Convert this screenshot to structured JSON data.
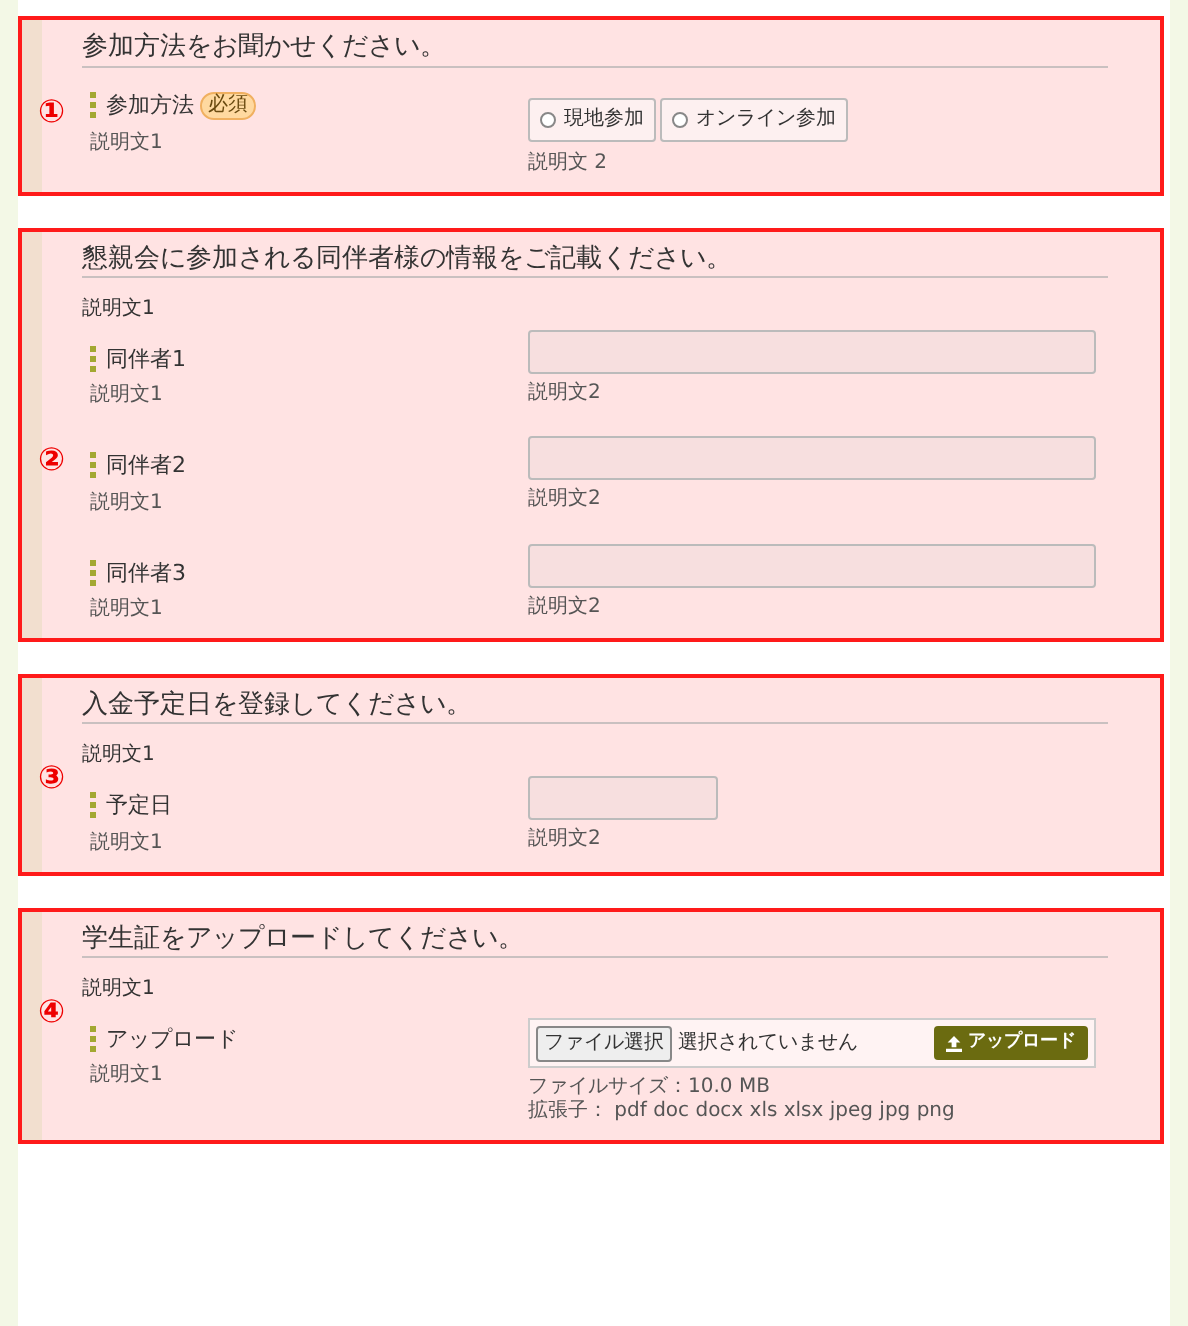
{
  "sections": [
    {
      "number": "①",
      "heading": "参加方法をお聞かせください。",
      "fields": [
        {
          "kind": "radio",
          "label": "参加方法",
          "required_badge": "必須",
          "note": "説明文1",
          "options": [
            {
              "label": "現地参加",
              "selected": false
            },
            {
              "label": "オンライン参加",
              "selected": false
            }
          ],
          "help": "説明文 2"
        }
      ]
    },
    {
      "number": "②",
      "heading": "懇親会に参加される同伴者様の情報をご記載ください。",
      "description": "説明文1",
      "fields": [
        {
          "kind": "text",
          "label": "同伴者1",
          "note": "説明文1",
          "help": "説明文2"
        },
        {
          "kind": "text",
          "label": "同伴者2",
          "note": "説明文1",
          "help": "説明文2"
        },
        {
          "kind": "text",
          "label": "同伴者3",
          "note": "説明文1",
          "help": "説明文2"
        }
      ]
    },
    {
      "number": "③",
      "heading": "入金予定日を登録してください。",
      "description": "説明文1",
      "fields": [
        {
          "kind": "date",
          "label": "予定日",
          "note": "説明文1",
          "help": "説明文2"
        }
      ]
    },
    {
      "number": "④",
      "heading": "学生証をアップロードしてください。",
      "description": "説明文1",
      "fields": [
        {
          "kind": "file",
          "label": "アップロード",
          "note": "説明文1",
          "file_button": "ファイル選択",
          "file_status": "選択されていません",
          "upload_button": "アップロード",
          "info": [
            "ファイルサイズ：10.0 MB",
            "拡張子： pdf doc docx xls xlsx jpeg jpg png"
          ]
        }
      ]
    }
  ]
}
